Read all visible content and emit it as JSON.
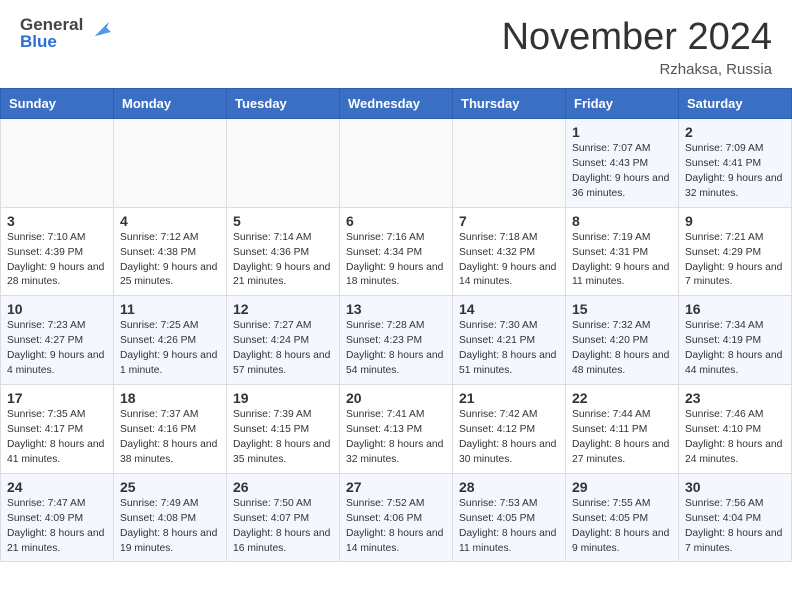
{
  "header": {
    "logo_general": "General",
    "logo_blue": "Blue",
    "month_title": "November 2024",
    "location": "Rzhaksa, Russia"
  },
  "weekdays": [
    "Sunday",
    "Monday",
    "Tuesday",
    "Wednesday",
    "Thursday",
    "Friday",
    "Saturday"
  ],
  "weeks": [
    [
      {
        "day": "",
        "info": ""
      },
      {
        "day": "",
        "info": ""
      },
      {
        "day": "",
        "info": ""
      },
      {
        "day": "",
        "info": ""
      },
      {
        "day": "",
        "info": ""
      },
      {
        "day": "1",
        "info": "Sunrise: 7:07 AM\nSunset: 4:43 PM\nDaylight: 9 hours and 36 minutes."
      },
      {
        "day": "2",
        "info": "Sunrise: 7:09 AM\nSunset: 4:41 PM\nDaylight: 9 hours and 32 minutes."
      }
    ],
    [
      {
        "day": "3",
        "info": "Sunrise: 7:10 AM\nSunset: 4:39 PM\nDaylight: 9 hours and 28 minutes."
      },
      {
        "day": "4",
        "info": "Sunrise: 7:12 AM\nSunset: 4:38 PM\nDaylight: 9 hours and 25 minutes."
      },
      {
        "day": "5",
        "info": "Sunrise: 7:14 AM\nSunset: 4:36 PM\nDaylight: 9 hours and 21 minutes."
      },
      {
        "day": "6",
        "info": "Sunrise: 7:16 AM\nSunset: 4:34 PM\nDaylight: 9 hours and 18 minutes."
      },
      {
        "day": "7",
        "info": "Sunrise: 7:18 AM\nSunset: 4:32 PM\nDaylight: 9 hours and 14 minutes."
      },
      {
        "day": "8",
        "info": "Sunrise: 7:19 AM\nSunset: 4:31 PM\nDaylight: 9 hours and 11 minutes."
      },
      {
        "day": "9",
        "info": "Sunrise: 7:21 AM\nSunset: 4:29 PM\nDaylight: 9 hours and 7 minutes."
      }
    ],
    [
      {
        "day": "10",
        "info": "Sunrise: 7:23 AM\nSunset: 4:27 PM\nDaylight: 9 hours and 4 minutes."
      },
      {
        "day": "11",
        "info": "Sunrise: 7:25 AM\nSunset: 4:26 PM\nDaylight: 9 hours and 1 minute."
      },
      {
        "day": "12",
        "info": "Sunrise: 7:27 AM\nSunset: 4:24 PM\nDaylight: 8 hours and 57 minutes."
      },
      {
        "day": "13",
        "info": "Sunrise: 7:28 AM\nSunset: 4:23 PM\nDaylight: 8 hours and 54 minutes."
      },
      {
        "day": "14",
        "info": "Sunrise: 7:30 AM\nSunset: 4:21 PM\nDaylight: 8 hours and 51 minutes."
      },
      {
        "day": "15",
        "info": "Sunrise: 7:32 AM\nSunset: 4:20 PM\nDaylight: 8 hours and 48 minutes."
      },
      {
        "day": "16",
        "info": "Sunrise: 7:34 AM\nSunset: 4:19 PM\nDaylight: 8 hours and 44 minutes."
      }
    ],
    [
      {
        "day": "17",
        "info": "Sunrise: 7:35 AM\nSunset: 4:17 PM\nDaylight: 8 hours and 41 minutes."
      },
      {
        "day": "18",
        "info": "Sunrise: 7:37 AM\nSunset: 4:16 PM\nDaylight: 8 hours and 38 minutes."
      },
      {
        "day": "19",
        "info": "Sunrise: 7:39 AM\nSunset: 4:15 PM\nDaylight: 8 hours and 35 minutes."
      },
      {
        "day": "20",
        "info": "Sunrise: 7:41 AM\nSunset: 4:13 PM\nDaylight: 8 hours and 32 minutes."
      },
      {
        "day": "21",
        "info": "Sunrise: 7:42 AM\nSunset: 4:12 PM\nDaylight: 8 hours and 30 minutes."
      },
      {
        "day": "22",
        "info": "Sunrise: 7:44 AM\nSunset: 4:11 PM\nDaylight: 8 hours and 27 minutes."
      },
      {
        "day": "23",
        "info": "Sunrise: 7:46 AM\nSunset: 4:10 PM\nDaylight: 8 hours and 24 minutes."
      }
    ],
    [
      {
        "day": "24",
        "info": "Sunrise: 7:47 AM\nSunset: 4:09 PM\nDaylight: 8 hours and 21 minutes."
      },
      {
        "day": "25",
        "info": "Sunrise: 7:49 AM\nSunset: 4:08 PM\nDaylight: 8 hours and 19 minutes."
      },
      {
        "day": "26",
        "info": "Sunrise: 7:50 AM\nSunset: 4:07 PM\nDaylight: 8 hours and 16 minutes."
      },
      {
        "day": "27",
        "info": "Sunrise: 7:52 AM\nSunset: 4:06 PM\nDaylight: 8 hours and 14 minutes."
      },
      {
        "day": "28",
        "info": "Sunrise: 7:53 AM\nSunset: 4:05 PM\nDaylight: 8 hours and 11 minutes."
      },
      {
        "day": "29",
        "info": "Sunrise: 7:55 AM\nSunset: 4:05 PM\nDaylight: 8 hours and 9 minutes."
      },
      {
        "day": "30",
        "info": "Sunrise: 7:56 AM\nSunset: 4:04 PM\nDaylight: 8 hours and 7 minutes."
      }
    ]
  ]
}
